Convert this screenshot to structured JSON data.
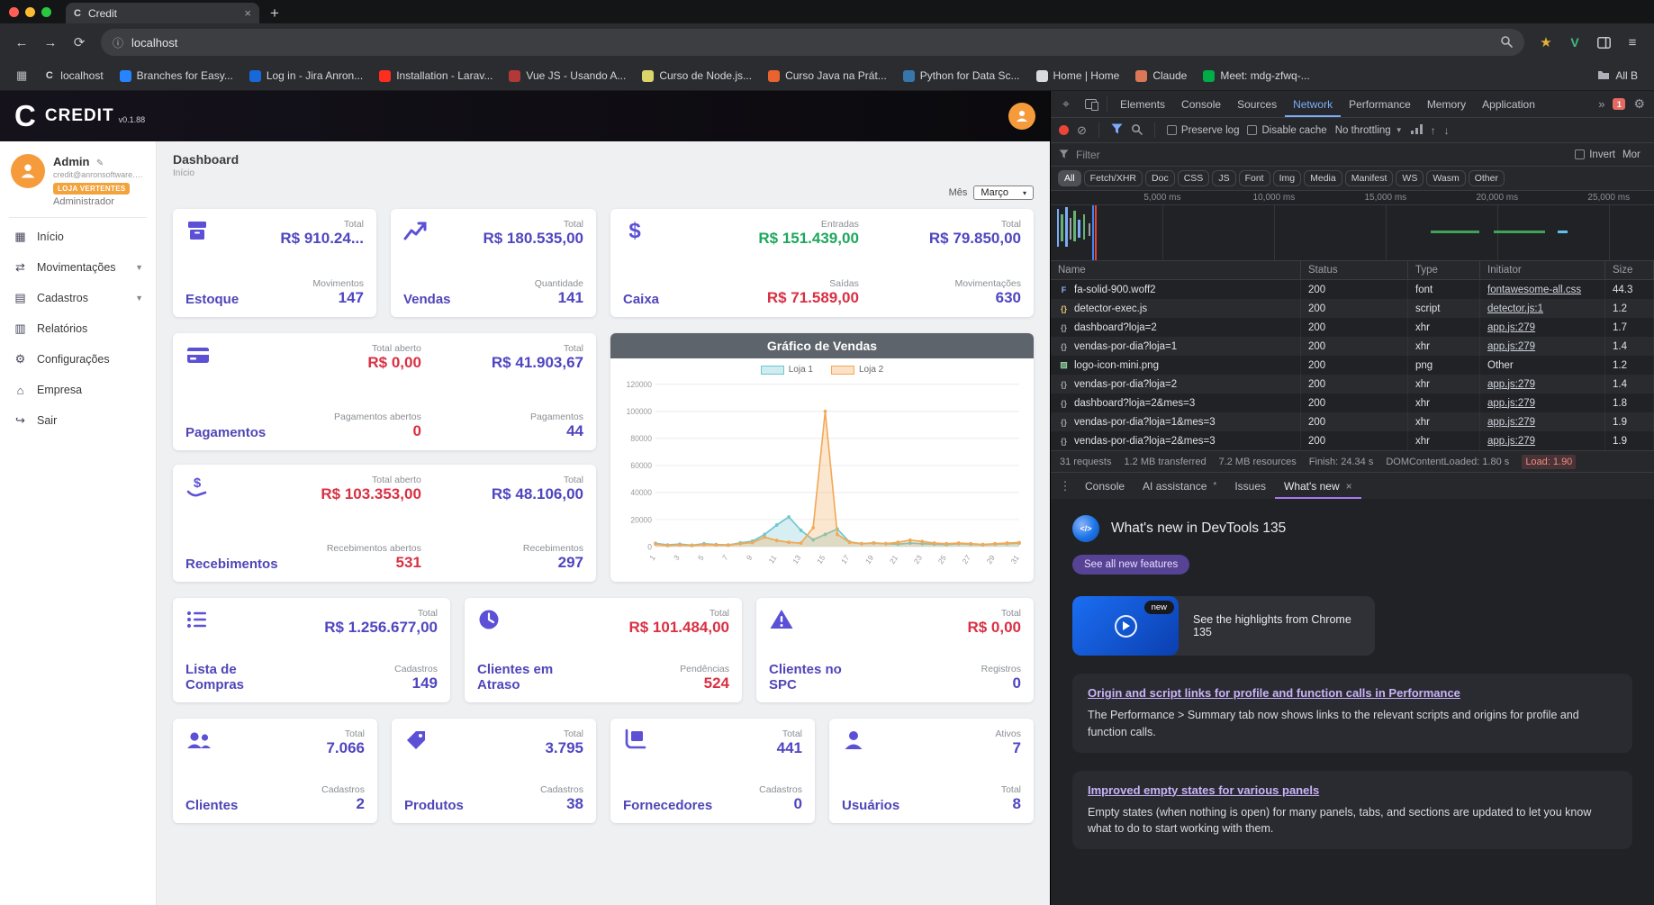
{
  "browser": {
    "tab": {
      "favicon_letter": "C",
      "title": "Credit"
    },
    "url": "localhost",
    "bookmarks": [
      {
        "label": "localhost",
        "letter": "C",
        "color": "#9aa0a6"
      },
      {
        "label": "Branches for Easy...",
        "color": "#2684ff"
      },
      {
        "label": "Log in - Jira Anron...",
        "color": "#1868db"
      },
      {
        "label": "Installation - Larav...",
        "color": "#ff2d20"
      },
      {
        "label": "Vue JS - Usando A...",
        "color": "#b33939"
      },
      {
        "label": "Curso de Node.js...",
        "color": "#d9d56a"
      },
      {
        "label": "Curso Java na Prát...",
        "color": "#e8632e"
      },
      {
        "label": "Python for Data Sc...",
        "color": "#3776ab"
      },
      {
        "label": "Home | Home",
        "color": "#d8dade"
      },
      {
        "label": "Claude",
        "color": "#d97757"
      },
      {
        "label": "Meet: mdg-zfwq-...",
        "color": "#00ac47"
      }
    ],
    "all_bookmarks_label": "All B"
  },
  "app": {
    "logo_letter": "C",
    "brand": "CREDIT",
    "version": "v0.1.88",
    "user": {
      "name": "Admin",
      "email": "credit@anronsoftware.co...",
      "store": "LOJA VERTENTES",
      "role": "Administrador"
    },
    "menu": [
      {
        "label": "Início",
        "icon": "grid"
      },
      {
        "label": "Movimentações",
        "icon": "transfer",
        "expandable": true
      },
      {
        "label": "Cadastros",
        "icon": "records",
        "expandable": true
      },
      {
        "label": "Relatórios",
        "icon": "report"
      },
      {
        "label": "Configurações",
        "icon": "gear"
      },
      {
        "label": "Empresa",
        "icon": "building"
      },
      {
        "label": "Sair",
        "icon": "logout"
      }
    ],
    "page": {
      "title": "Dashboard",
      "subtitle": "Início",
      "month_label": "Mês",
      "month_value": "Março"
    },
    "cards": [
      {
        "id": "estoque",
        "title": "Estoque",
        "icon": "box",
        "layout": "stack",
        "stats": [
          {
            "label": "Total",
            "value": "R$ 910.24...",
            "color": "purple"
          },
          {
            "label": "Movimentos",
            "value": "147",
            "color": "purple"
          }
        ]
      },
      {
        "id": "vendas",
        "title": "Vendas",
        "icon": "chart",
        "layout": "stack",
        "stats": [
          {
            "label": "Total",
            "value": "R$ 180.535,00",
            "color": "purple"
          },
          {
            "label": "Quantidade",
            "value": "141",
            "color": "purple"
          }
        ]
      },
      {
        "id": "caixa",
        "title": "Caixa",
        "icon": "dollar",
        "layout": "grid",
        "stats": [
          {
            "label": "Entradas",
            "value": "R$ 151.439,00",
            "color": "green"
          },
          {
            "label": "Total",
            "value": "R$ 79.850,00",
            "color": "purple"
          },
          {
            "label": "Saídas",
            "value": "R$ 71.589,00",
            "color": "red"
          },
          {
            "label": "Movimentações",
            "value": "630",
            "color": "purple"
          }
        ]
      },
      {
        "id": "pagamentos",
        "title": "Pagamentos",
        "icon": "card",
        "layout": "grid",
        "stats": [
          {
            "label": "Total aberto",
            "value": "R$ 0,00",
            "color": "red"
          },
          {
            "label": "Total",
            "value": "R$ 41.903,67",
            "color": "purple"
          },
          {
            "label": "Pagamentos abertos",
            "value": "0",
            "color": "red"
          },
          {
            "label": "Pagamentos",
            "value": "44",
            "color": "purple"
          }
        ]
      },
      {
        "id": "recebimentos",
        "title": "Recebimentos",
        "icon": "receive",
        "layout": "grid",
        "stats": [
          {
            "label": "Total aberto",
            "value": "R$ 103.353,00",
            "color": "red"
          },
          {
            "label": "Total",
            "value": "R$ 48.106,00",
            "color": "purple"
          },
          {
            "label": "Recebimentos abertos",
            "value": "531",
            "color": "red"
          },
          {
            "label": "Recebimentos",
            "value": "297",
            "color": "purple"
          }
        ]
      },
      {
        "id": "lista-compras",
        "title": "Lista de Compras",
        "icon": "list",
        "layout": "stack",
        "stats": [
          {
            "label": "Total",
            "value": "R$ 1.256.677,00",
            "color": "purple"
          },
          {
            "label": "Cadastros",
            "value": "149",
            "color": "purple"
          }
        ]
      },
      {
        "id": "clientes-atraso",
        "title": "Clientes em Atraso",
        "icon": "clock",
        "layout": "stack",
        "stats": [
          {
            "label": "Total",
            "value": "R$ 101.484,00",
            "color": "red"
          },
          {
            "label": "Pendências",
            "value": "524",
            "color": "red"
          }
        ]
      },
      {
        "id": "clientes-spc",
        "title": "Clientes no SPC",
        "icon": "warning",
        "layout": "stack",
        "stats": [
          {
            "label": "Total",
            "value": "R$ 0,00",
            "color": "red"
          },
          {
            "label": "Registros",
            "value": "0",
            "color": "purple"
          }
        ]
      },
      {
        "id": "clientes",
        "title": "Clientes",
        "icon": "people",
        "layout": "stack",
        "stats": [
          {
            "label": "Total",
            "value": "7.066",
            "color": "purple"
          },
          {
            "label": "Cadastros",
            "value": "2",
            "color": "purple"
          }
        ]
      },
      {
        "id": "produtos",
        "title": "Produtos",
        "icon": "tag",
        "layout": "stack",
        "stats": [
          {
            "label": "Total",
            "value": "3.795",
            "color": "purple"
          },
          {
            "label": "Cadastros",
            "value": "38",
            "color": "purple"
          }
        ]
      },
      {
        "id": "fornecedores",
        "title": "Fornecedores",
        "icon": "truck",
        "layout": "stack",
        "stats": [
          {
            "label": "Total",
            "value": "441",
            "color": "purple"
          },
          {
            "label": "Cadastros",
            "value": "0",
            "color": "purple"
          }
        ]
      },
      {
        "id": "usuarios",
        "title": "Usuários",
        "icon": "user",
        "layout": "stack",
        "stats": [
          {
            "label": "Ativos",
            "value": "7",
            "color": "purple"
          },
          {
            "label": "Total",
            "value": "8",
            "color": "purple"
          }
        ]
      }
    ]
  },
  "chart_data": {
    "type": "line",
    "title": "Gráfico de Vendas",
    "x": [
      1,
      2,
      3,
      4,
      5,
      6,
      7,
      8,
      9,
      10,
      11,
      12,
      13,
      14,
      15,
      16,
      17,
      18,
      19,
      20,
      21,
      22,
      23,
      24,
      25,
      26,
      27,
      28,
      29,
      30,
      31
    ],
    "series": [
      {
        "name": "Loja 1",
        "color": "#6fc7cf",
        "values": [
          2500,
          1200,
          1800,
          1000,
          2200,
          1500,
          1200,
          2800,
          4000,
          9000,
          16000,
          22000,
          12000,
          5000,
          9000,
          13000,
          3500,
          2200,
          2800,
          2200,
          1800,
          2600,
          2200,
          1800,
          1500,
          2200,
          1800,
          1400,
          1800,
          2200,
          2600
        ]
      },
      {
        "name": "Loja 2",
        "color": "#f2a854",
        "values": [
          2000,
          800,
          1200,
          900,
          1600,
          1300,
          1100,
          2200,
          3000,
          7000,
          4500,
          3200,
          2600,
          14000,
          100000,
          9000,
          3200,
          2200,
          2600,
          2200,
          3200,
          4800,
          3800,
          2600,
          2200,
          2600,
          2200,
          1600,
          2200,
          2600,
          3000
        ]
      }
    ],
    "ylim": [
      0,
      120000
    ],
    "yticks": [
      0,
      20000,
      40000,
      60000,
      80000,
      100000,
      120000
    ],
    "legend_position": "top",
    "grid": true
  },
  "devtools": {
    "tabs": [
      "Elements",
      "Console",
      "Sources",
      "Network",
      "Performance",
      "Memory",
      "Application"
    ],
    "active_tab": "Network",
    "error_badge": "1",
    "network_toolbar": {
      "preserve_log": "Preserve log",
      "disable_cache": "Disable cache",
      "throttling": "No throttling"
    },
    "filter_row": {
      "placeholder": "Filter",
      "invert_label": "Invert",
      "more_label": "Mor"
    },
    "type_filters": [
      "All",
      "Fetch/XHR",
      "Doc",
      "CSS",
      "JS",
      "Font",
      "Img",
      "Media",
      "Manifest",
      "WS",
      "Wasm",
      "Other"
    ],
    "active_type_filter": "All",
    "timeline_ticks": [
      "5,000 ms",
      "10,000 ms",
      "15,000 ms",
      "20,000 ms",
      "25,000 ms"
    ],
    "columns": [
      "Name",
      "Status",
      "Type",
      "Initiator",
      "Size"
    ],
    "requests": [
      {
        "name": "fa-solid-900.woff2",
        "status": "200",
        "type": "font",
        "initiator": "fontawesome-all.css",
        "initiator_is_link": true,
        "size": "44.3",
        "icon": "font"
      },
      {
        "name": "detector-exec.js",
        "status": "200",
        "type": "script",
        "initiator": "detector.js:1",
        "initiator_is_link": true,
        "size": "1.2",
        "icon": "script"
      },
      {
        "name": "dashboard?loja=2",
        "status": "200",
        "type": "xhr",
        "initiator": "app.js:279",
        "initiator_is_link": true,
        "size": "1.7",
        "icon": "xhr"
      },
      {
        "name": "vendas-por-dia?loja=1",
        "status": "200",
        "type": "xhr",
        "initiator": "app.js:279",
        "initiator_is_link": true,
        "size": "1.4",
        "icon": "xhr"
      },
      {
        "name": "logo-icon-mini.png",
        "status": "200",
        "type": "png",
        "initiator": "Other",
        "initiator_is_link": false,
        "size": "1.2",
        "icon": "image"
      },
      {
        "name": "vendas-por-dia?loja=2",
        "status": "200",
        "type": "xhr",
        "initiator": "app.js:279",
        "initiator_is_link": true,
        "size": "1.4",
        "icon": "xhr"
      },
      {
        "name": "dashboard?loja=2&mes=3",
        "status": "200",
        "type": "xhr",
        "initiator": "app.js:279",
        "initiator_is_link": true,
        "size": "1.8",
        "icon": "xhr"
      },
      {
        "name": "vendas-por-dia?loja=1&mes=3",
        "status": "200",
        "type": "xhr",
        "initiator": "app.js:279",
        "initiator_is_link": true,
        "size": "1.9",
        "icon": "xhr"
      },
      {
        "name": "vendas-por-dia?loja=2&mes=3",
        "status": "200",
        "type": "xhr",
        "initiator": "app.js:279",
        "initiator_is_link": true,
        "size": "1.9",
        "icon": "xhr"
      }
    ],
    "summary": [
      {
        "text": "31 requests"
      },
      {
        "text": "1.2 MB transferred"
      },
      {
        "text": "7.2 MB resources"
      },
      {
        "text": "Finish: 24.34 s"
      },
      {
        "text": "DOMContentLoaded: 1.80 s",
        "style": "dcl"
      },
      {
        "text": "Load: 1.90",
        "style": "load"
      }
    ],
    "drawer_tabs": [
      "Console",
      "AI assistance",
      "Issues",
      "What's new"
    ],
    "drawer_active_tab": "What's new",
    "whats_new": {
      "heading": "What's new in DevTools 135",
      "see_all_button": "See all new features",
      "highlight": {
        "badge": "new",
        "text": "See the highlights from Chrome 135"
      },
      "articles": [
        {
          "title": "Origin and script links for profile and function calls in Performance",
          "body": "The Performance > Summary tab now shows links to the relevant scripts and origins for profile and function calls."
        },
        {
          "title": "Improved empty states for various panels",
          "body": "Empty states (when nothing is open) for many panels, tabs, and sections are updated to let you know what to do to start working with them."
        }
      ]
    }
  },
  "colors": {
    "primary_purple": "#4f46c0",
    "icon_purple": "#5b50d6",
    "danger_red": "#d93043",
    "success_green": "#1ea75c",
    "badge_orange": "#f2a33c",
    "devtools_accent_blue": "#7cacf8",
    "whatsnew_accent_purple": "#a878f2"
  }
}
